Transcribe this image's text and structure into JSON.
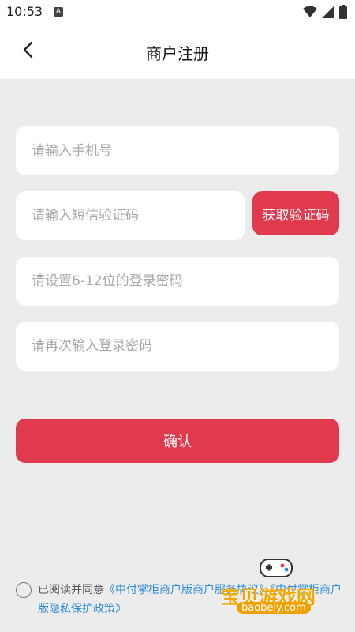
{
  "status_bar": {
    "time": "10:53",
    "notification_icon": "A"
  },
  "header": {
    "title": "商户注册",
    "back_icon": "chevron-left-icon"
  },
  "form": {
    "phone_placeholder": "请输入手机号",
    "sms_placeholder": "请输入短信验证码",
    "get_code_label": "获取验证码",
    "password_placeholder": "请设置6-12位的登录密码",
    "confirm_password_placeholder": "请再次输入登录密码",
    "confirm_label": "确认"
  },
  "agreement": {
    "prefix": "已阅读并同意",
    "link1": "《中付掌柜商户版商户服务协议》",
    "link2": "《中付掌柜商户版隐私保护政策》"
  },
  "watermark": {
    "text": "宝贝游戏网",
    "url": "baobeiy.com"
  },
  "colors": {
    "accent": "#e23a4d",
    "link": "#2b8ad8",
    "background": "#ececec"
  }
}
